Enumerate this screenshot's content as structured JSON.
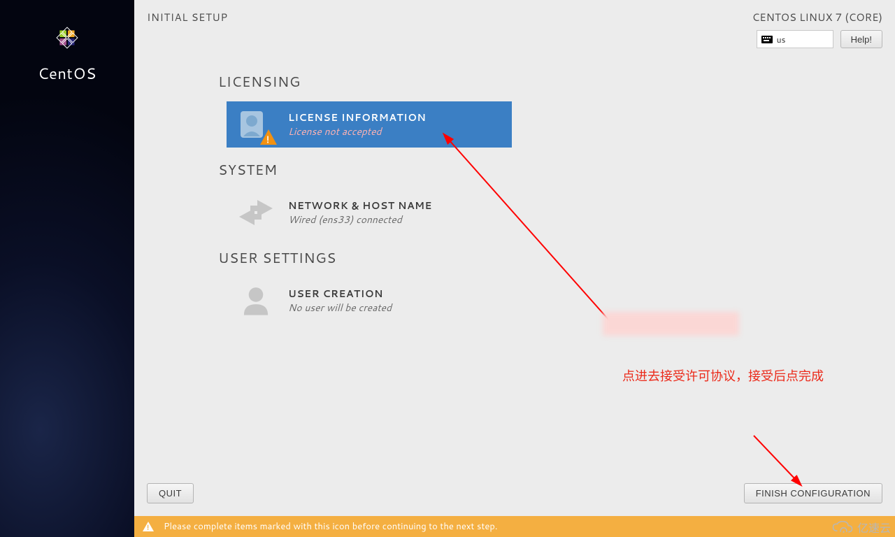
{
  "sidebar": {
    "brand": "CentOS"
  },
  "header": {
    "title": "INITIAL SETUP",
    "distro": "CENTOS LINUX 7 (CORE)",
    "keyboard_layout": "us",
    "help_label": "Help!"
  },
  "sections": {
    "licensing": {
      "heading": "LICENSING",
      "spoke_title": "LICENSE INFORMATION",
      "spoke_status": "License not accepted"
    },
    "system": {
      "heading": "SYSTEM",
      "spoke_title": "NETWORK & HOST NAME",
      "spoke_status": "Wired (ens33) connected"
    },
    "user": {
      "heading": "USER SETTINGS",
      "spoke_title": "USER CREATION",
      "spoke_status": "No user will be created"
    }
  },
  "footer": {
    "quit_label": "QUIT",
    "finish_label": "FINISH CONFIGURATION",
    "status_message": "Please complete items marked with this icon before continuing to the next step."
  },
  "annotations": {
    "note_text": "点进去接受许可协议，接受后点完成",
    "watermark_text": "亿速云"
  }
}
